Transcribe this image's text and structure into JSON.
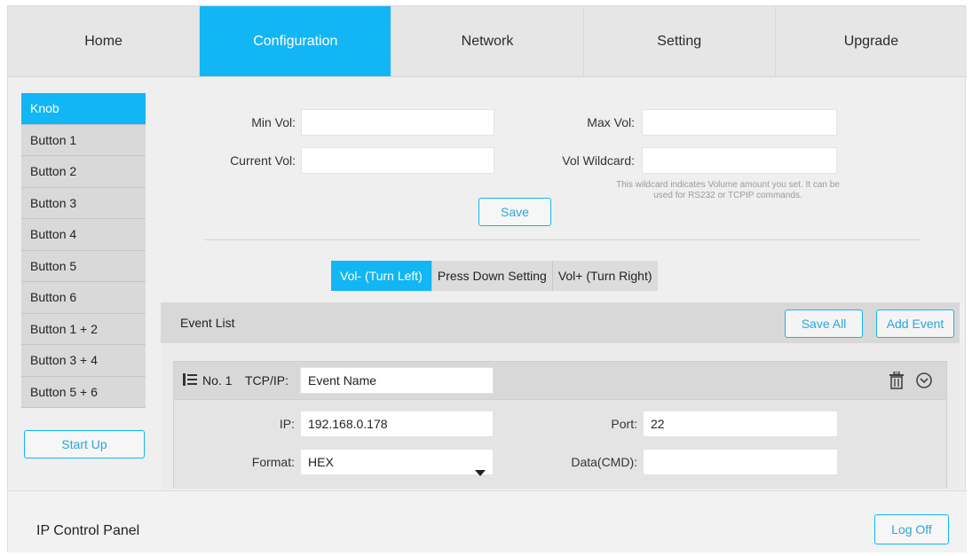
{
  "nav": {
    "tabs": [
      {
        "label": "Home"
      },
      {
        "label": "Configuration"
      },
      {
        "label": "Network"
      },
      {
        "label": "Setting"
      },
      {
        "label": "Upgrade"
      }
    ],
    "active": "Configuration"
  },
  "sidebar": {
    "items": [
      {
        "label": "Knob"
      },
      {
        "label": "Button 1"
      },
      {
        "label": "Button 2"
      },
      {
        "label": "Button 3"
      },
      {
        "label": "Button 4"
      },
      {
        "label": "Button 5"
      },
      {
        "label": "Button 6"
      },
      {
        "label": "Button 1 + 2"
      },
      {
        "label": "Button 3 + 4"
      },
      {
        "label": "Button 5 + 6"
      }
    ],
    "active": "Knob",
    "startup_label": "Start Up"
  },
  "volume": {
    "min_label": "Min Vol:",
    "min_value": "",
    "max_label": "Max Vol:",
    "max_value": "",
    "current_label": "Current Vol:",
    "current_value": "",
    "wildcard_label": "Vol Wildcard:",
    "wildcard_value": "",
    "hint": "This wildcard indicates Volume amount you set. It can be used for RS232 or TCPIP commands.",
    "save_label": "Save"
  },
  "subtabs": {
    "items": [
      {
        "label": "Vol- (Turn Left)"
      },
      {
        "label": "Press Down Setting"
      },
      {
        "label": "Vol+ (Turn Right)"
      }
    ],
    "active": "Vol- (Turn Left)"
  },
  "event_list": {
    "title": "Event List",
    "save_all_label": "Save All",
    "add_event_label": "Add Event",
    "event": {
      "number": "No. 1",
      "type": "TCP/IP:",
      "name": "Event Name",
      "ip_label": "IP:",
      "ip_value": "192.168.0.178",
      "port_label": "Port:",
      "port_value": "22",
      "format_label": "Format:",
      "format_value": "HEX",
      "data_label": "Data(CMD):",
      "data_value": ""
    }
  },
  "footer": {
    "title": "IP Control Panel",
    "logoff_label": "Log Off"
  },
  "colors": {
    "accent": "#12b6f4",
    "background": "#efefef"
  }
}
